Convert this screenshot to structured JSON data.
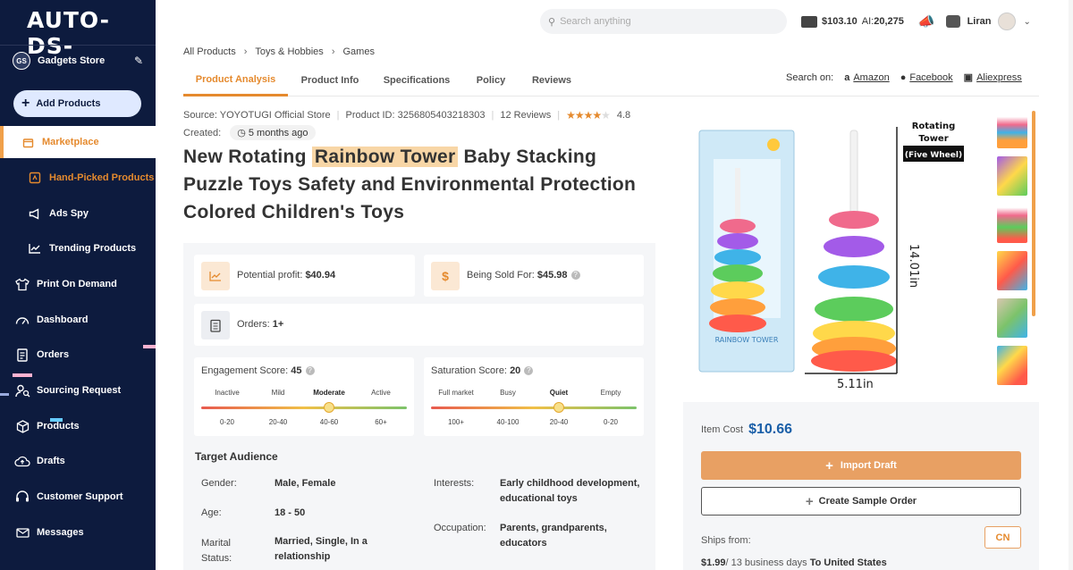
{
  "app": {
    "logo": "AUTO-DS-"
  },
  "sidebar": {
    "store": {
      "initials": "GS",
      "name": "Gadgets Store"
    },
    "add_products": "Add Products",
    "items": [
      {
        "label": "Marketplace",
        "icon": "store-icon"
      },
      {
        "label": "Hand-Picked Products",
        "icon": "hand-picked-icon"
      },
      {
        "label": "Ads Spy",
        "icon": "megaphone-icon"
      },
      {
        "label": "Trending Products",
        "icon": "trending-icon"
      },
      {
        "label": "Print On Demand",
        "icon": "shirt-icon"
      },
      {
        "label": "Dashboard",
        "icon": "dashboard-icon"
      },
      {
        "label": "Orders",
        "icon": "orders-icon"
      },
      {
        "label": "Sourcing Request",
        "icon": "sourcing-icon"
      },
      {
        "label": "Products",
        "icon": "box-icon"
      },
      {
        "label": "Drafts",
        "icon": "cloud-upload-icon"
      },
      {
        "label": "Customer Support",
        "icon": "headset-icon"
      },
      {
        "label": "Messages",
        "icon": "mail-icon"
      }
    ]
  },
  "header": {
    "search_placeholder": "Search anything",
    "balance": "$103.10",
    "ai_label": "AI:",
    "ai_value": "20,275",
    "user": "Liran"
  },
  "breadcrumb": [
    "All Products",
    "Toys & Hobbies",
    "Games"
  ],
  "tabs": [
    "Product Analysis",
    "Product Info",
    "Specifications",
    "Policy",
    "Reviews"
  ],
  "search_on": {
    "label": "Search on:",
    "links": [
      "Amazon",
      "Facebook",
      "Aliexpress"
    ]
  },
  "product": {
    "source": "Source: YOYOTUGI Official Store",
    "product_id": "Product ID: 3256805403218303",
    "reviews": "12 Reviews",
    "rating": "4.8",
    "created_label": "Created:",
    "created_value": "5 months ago",
    "title_pre": "New Rotating ",
    "title_hl": "Rainbow Tower",
    "title_post": " Baby Stacking Puzzle Toys Safety and Environmental Protection Colored Children's Toys"
  },
  "stats": {
    "profit_label": "Potential profit:",
    "profit_value": "$40.94",
    "sold_label": "Being Sold For:",
    "sold_value": "$45.98",
    "orders_label": "Orders:",
    "orders_value": "1+",
    "engagement": {
      "label": "Engagement Score:",
      "value": "45",
      "levels": [
        "Inactive",
        "Mild",
        "Moderate",
        "Active"
      ],
      "ranges": [
        "0-20",
        "20-40",
        "40-60",
        "60+"
      ],
      "current": "Moderate"
    },
    "saturation": {
      "label": "Saturation Score:",
      "value": "20",
      "levels": [
        "Full market",
        "Busy",
        "Quiet",
        "Empty"
      ],
      "ranges": [
        "100+",
        "40-100",
        "20-40",
        "0-20"
      ],
      "current": "Quiet"
    }
  },
  "audience": {
    "title": "Target Audience",
    "gender_label": "Gender:",
    "gender": "Male, Female",
    "age_label": "Age:",
    "age": "18 - 50",
    "marital_label": "Marital Status:",
    "marital": "Married, Single, In a relationship",
    "interests_label": "Interests:",
    "interests": "Early childhood development, educational toys",
    "occupation_label": "Occupation:",
    "occupation": "Parents, grandparents, educators"
  },
  "image": {
    "caption_line1": "Rotating",
    "caption_line2": "Tower",
    "caption_tag": "(Five Wheel)",
    "height": "14.01in",
    "width": "5.11in",
    "box_text": "RAINBOW TOWER"
  },
  "purchase": {
    "item_cost_label": "Item Cost",
    "item_cost": "$10.66",
    "import_draft": "Import Draft",
    "create_sample": "Create Sample Order",
    "ships_from_label": "Ships from:",
    "ships_from": "CN",
    "ship_price": "$1.99",
    "ship_days": "/ 13 business days",
    "ship_to_label": "To",
    "ship_to": "United States"
  }
}
